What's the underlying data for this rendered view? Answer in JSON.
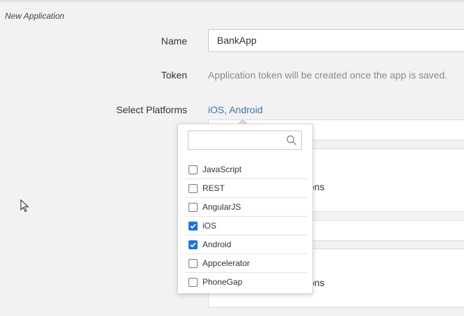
{
  "section_title": "New Application",
  "form": {
    "name_label": "Name",
    "name_value": "BankApp",
    "token_label": "Token",
    "token_text": "Application token will be created once the app is saved.",
    "platforms_label": "Select Platforms",
    "platforms_value": "iOS, Android"
  },
  "cards": [
    {
      "visible_text": "cations"
    },
    {
      "visible_text": "cations"
    }
  ],
  "dropdown": {
    "search_placeholder": "",
    "options": [
      {
        "label": "JavaScript",
        "checked": false
      },
      {
        "label": "REST",
        "checked": false
      },
      {
        "label": "AngularJS",
        "checked": false
      },
      {
        "label": "iOS",
        "checked": true
      },
      {
        "label": "Android",
        "checked": true
      },
      {
        "label": "Appcelerator",
        "checked": false
      },
      {
        "label": "PhoneGap",
        "checked": false
      }
    ]
  },
  "colors": {
    "link": "#3c74a8",
    "checkbox_checked": "#1a73e8"
  }
}
